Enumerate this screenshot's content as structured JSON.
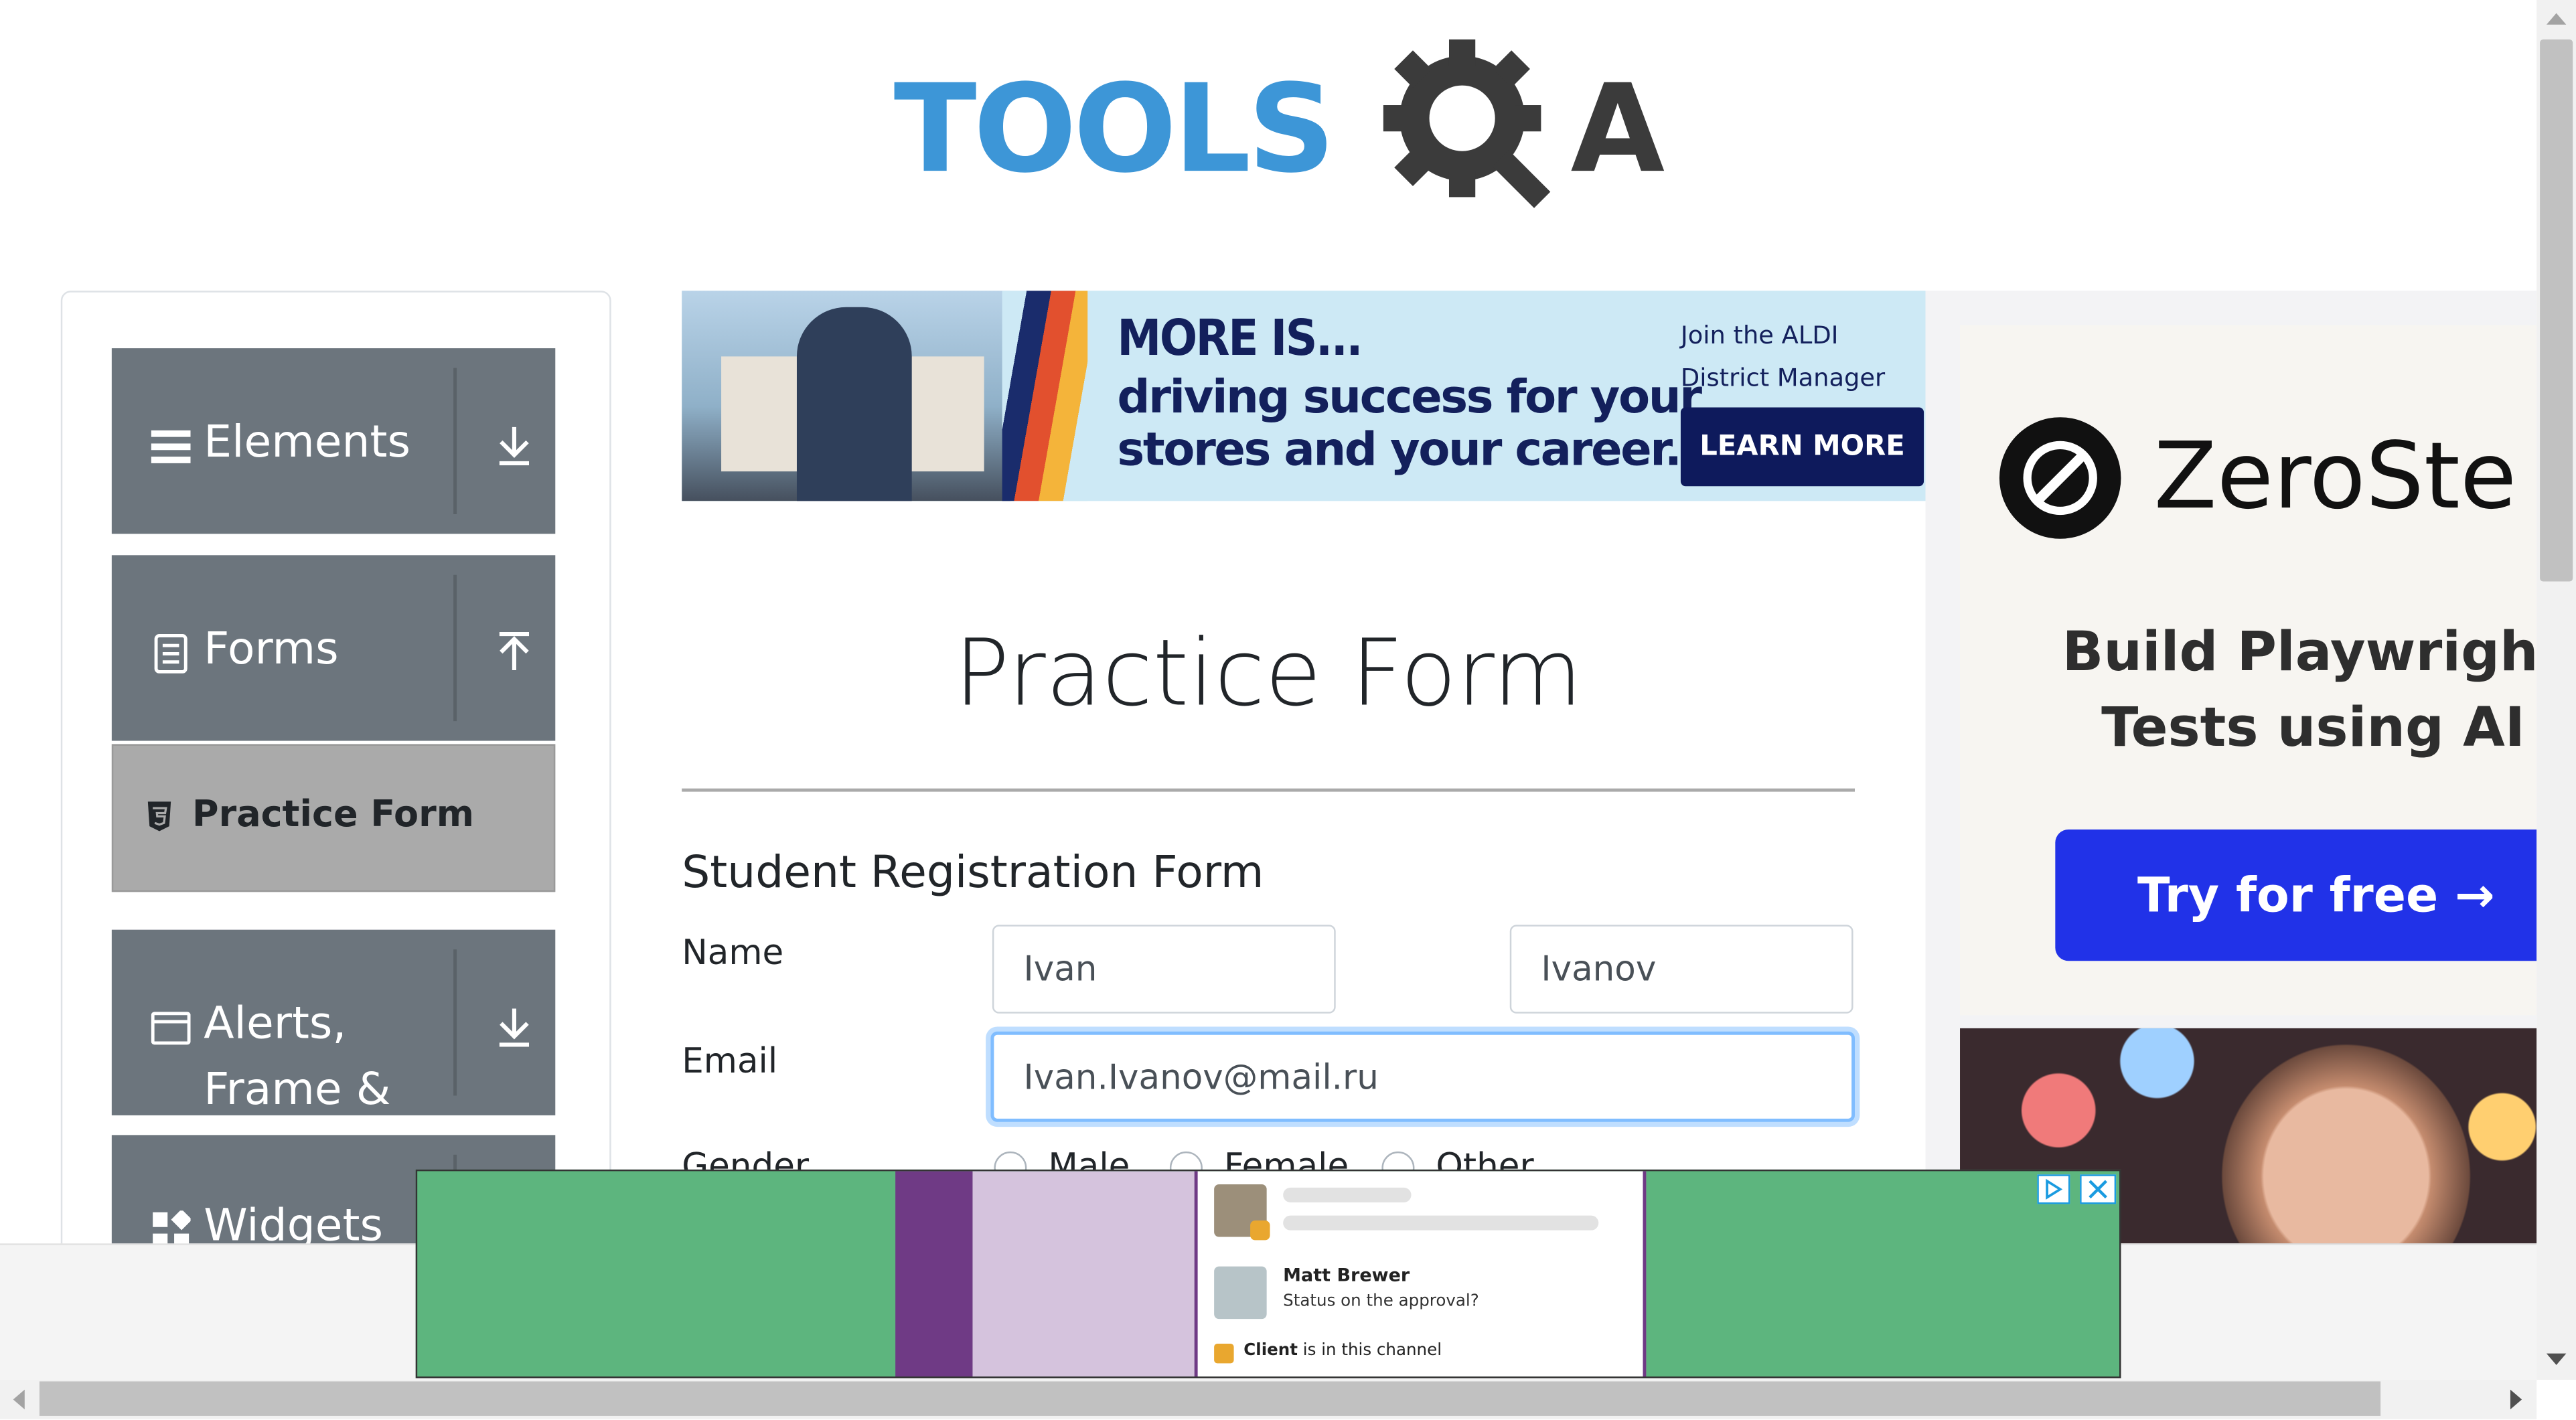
{
  "header": {
    "logo_text": "TOOLS",
    "logo_suffix": "A"
  },
  "sidebar": {
    "groups": [
      {
        "label": "Elements"
      },
      {
        "label": "Forms"
      },
      {
        "label": "Alerts, Frame & Windows"
      },
      {
        "label": "Widgets"
      }
    ],
    "active_item": "Practice Form"
  },
  "top_ad": {
    "headline": "MORE IS...",
    "line1": "driving success for your",
    "line2": "stores and your career.",
    "side_text": "Join the ALDI District Manager team.",
    "cta": "LEARN MORE"
  },
  "main": {
    "title": "Practice Form",
    "form_heading": "Student Registration Form",
    "name_label": "Name",
    "first_name_value": "Ivan",
    "last_name_value": "Ivanov",
    "email_label": "Email",
    "email_value": "Ivan.Ivanov@mail.ru",
    "gender_label": "Gender",
    "gender_options": [
      "Male",
      "Female",
      "Other"
    ]
  },
  "right_ad": {
    "brand": "ZeroSte",
    "tagline_line1": "Build Playwright",
    "tagline_line2": "Tests using AI",
    "cta": "Try for free →"
  },
  "bottom_ad": {
    "sender": "Matt Brewer",
    "message": "Status on the approval?",
    "client_bold": "Client",
    "client_rest": " is in this channel"
  },
  "colors": {
    "logo_blue": "#3d96d7",
    "sidebar_group": "#6c757d",
    "active_item": "#aaaaaa",
    "focus_border": "#80bdff",
    "zero_button": "#2132e8",
    "bottom_ad_green": "#5db57e"
  }
}
